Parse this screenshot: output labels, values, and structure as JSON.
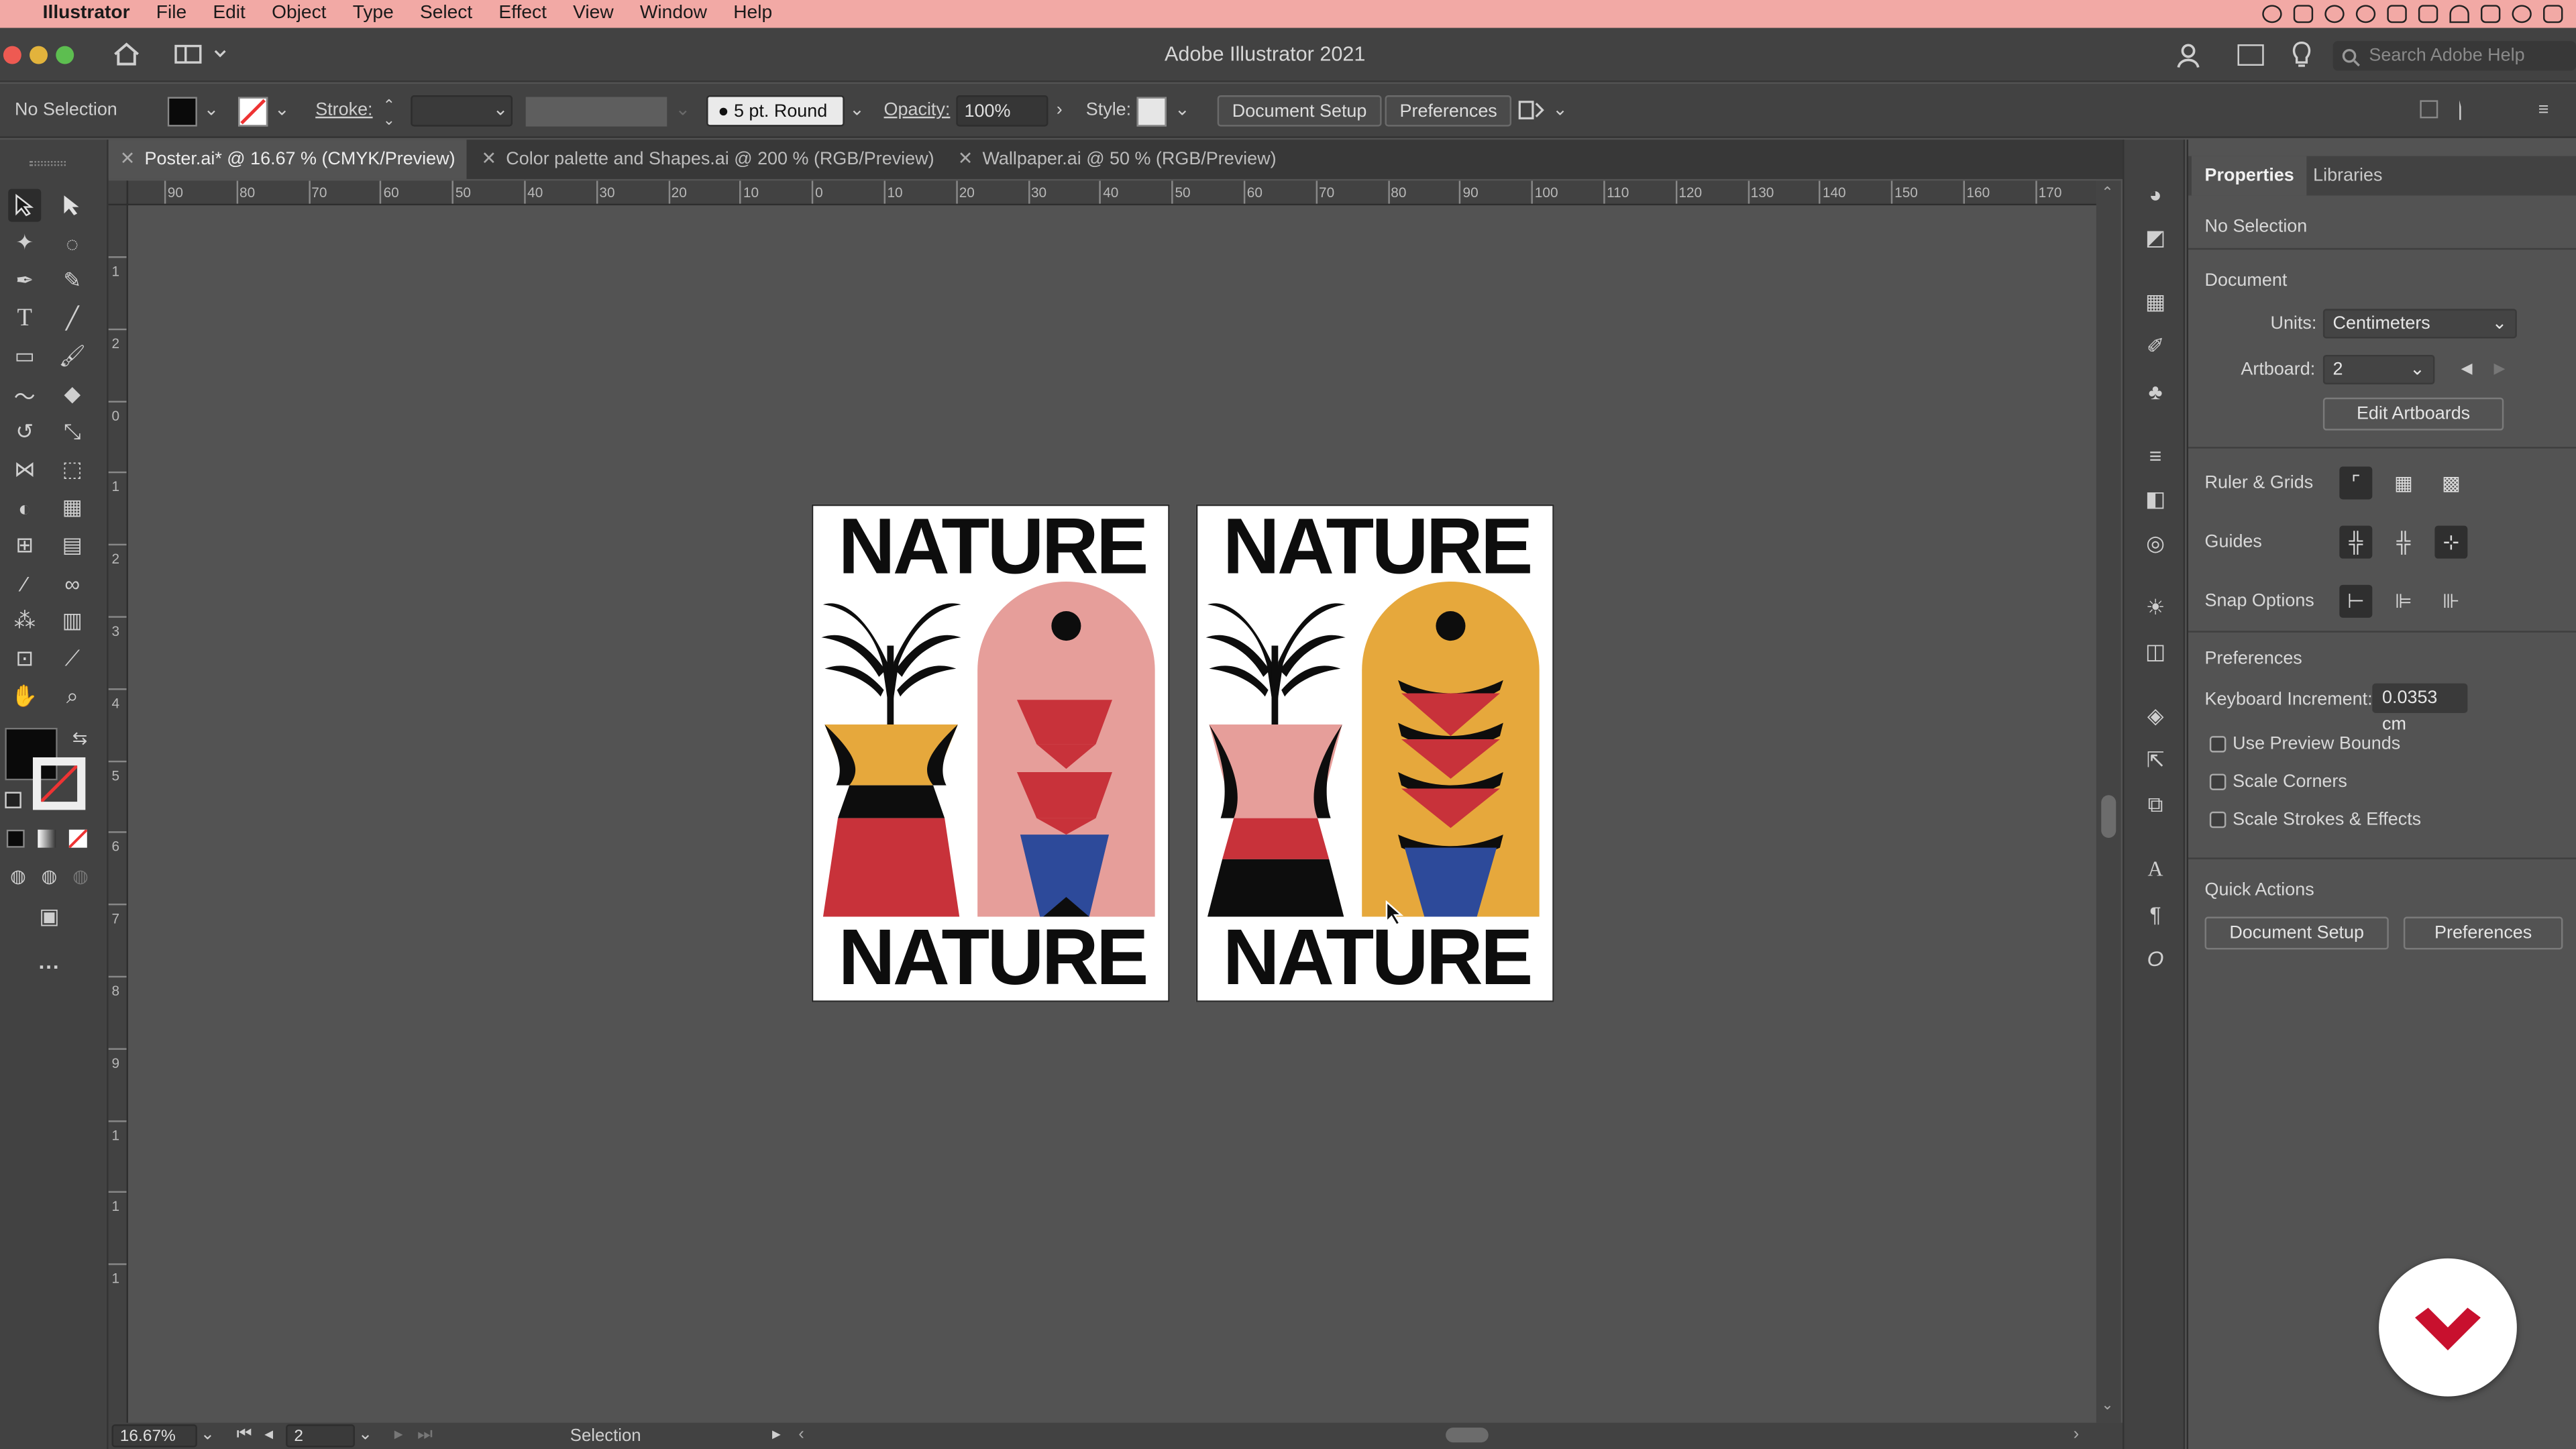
{
  "menubar": {
    "apple": "",
    "app": "Illustrator",
    "items": [
      "File",
      "Edit",
      "Object",
      "Type",
      "Select",
      "Effect",
      "View",
      "Window",
      "Help"
    ]
  },
  "window": {
    "title": "Adobe Illustrator 2021",
    "search_placeholder": "Search Adobe Help"
  },
  "control": {
    "selection": "No Selection",
    "stroke_label": "Stroke:",
    "brush": "5 pt. Round",
    "opacity_label": "Opacity:",
    "opacity": "100%",
    "style_label": "Style:",
    "document_setup": "Document Setup",
    "preferences": "Preferences"
  },
  "tabs": [
    {
      "label": "Poster.ai* @ 16.67 % (CMYK/Preview)",
      "active": true
    },
    {
      "label": "Color palette and Shapes.ai @ 200 % (RGB/Preview)",
      "active": false
    },
    {
      "label": "Wallpaper.ai @ 50 % (RGB/Preview)",
      "active": false
    }
  ],
  "ruler": {
    "h": [
      "90",
      "80",
      "70",
      "60",
      "50",
      "40",
      "30",
      "20",
      "10",
      "0",
      "10",
      "20",
      "30",
      "40",
      "50",
      "60",
      "70",
      "80",
      "90",
      "100",
      "110",
      "120",
      "130",
      "140",
      "150",
      "160",
      "170"
    ],
    "v": [
      "1",
      "2",
      "0",
      "1",
      "2",
      "3",
      "4",
      "5",
      "6",
      "7",
      "8",
      "9",
      "1",
      "1",
      "1"
    ]
  },
  "artwork": {
    "word": "NATURE",
    "palette": {
      "black": "#0d0d0d",
      "yellow": "#e6a83c",
      "red": "#c8323a",
      "pink": "#e69e9a",
      "blue": "#2d4a9a",
      "white": "#ffffff"
    }
  },
  "status": {
    "zoom": "16.67%",
    "artboard": "2",
    "tool": "Selection"
  },
  "properties": {
    "tabs": [
      "Properties",
      "Libraries"
    ],
    "selection": "No Selection",
    "document_heading": "Document",
    "units_label": "Units:",
    "units": "Centimeters",
    "artboard_label": "Artboard:",
    "artboard": "2",
    "edit_artboards": "Edit Artboards",
    "ruler_grids": "Ruler & Grids",
    "guides": "Guides",
    "snap_options": "Snap Options",
    "preferences_heading": "Preferences",
    "keyboard_increment_label": "Keyboard Increment:",
    "keyboard_increment": "0.0353 cm",
    "checks": [
      "Use Preview Bounds",
      "Scale Corners",
      "Scale Strokes & Effects"
    ],
    "quick_actions": "Quick Actions",
    "qa_document_setup": "Document Setup",
    "qa_preferences": "Preferences"
  },
  "colors": {
    "menubar": "#f2a9a5",
    "panel": "#424242",
    "canvas": "#535353",
    "fill": "#0a0a0a",
    "stroke_none": "#e33"
  }
}
